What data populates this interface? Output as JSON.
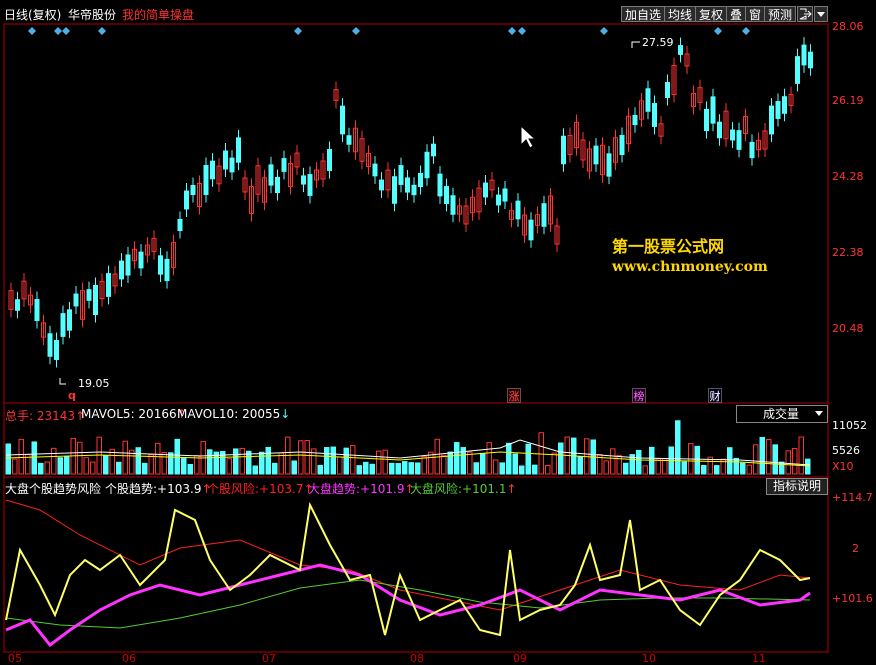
{
  "colors": {
    "up": "#ff3232",
    "down": "#54ffff",
    "frame": "#b00000",
    "axis": "#c00000",
    "ma5": "#ffffff",
    "ma10": "#ffff00",
    "yellow_line": "#ffff66",
    "red_line": "#ff2020",
    "magenta_line": "#ff33ff",
    "green_line": "#55cc33"
  },
  "header": {
    "period": "日线(复权)",
    "stock_name": "华帝股份",
    "template": "我的简单操盘",
    "buttons": [
      "加自选",
      "均线",
      "复权",
      "叠",
      "窗",
      "预测"
    ],
    "extra_icons": [
      "exit-icon",
      "dropdown-icon"
    ]
  },
  "price_axis": [
    "28.06",
    "26.19",
    "24.28",
    "22.38",
    "20.48"
  ],
  "high_marker": "27.59",
  "low_marker": "19.05",
  "low_tag": "q",
  "event_tags": [
    "涨",
    "榜",
    "财"
  ],
  "watermark": {
    "line1": "第一股票公式网",
    "line2": "www.chnmoney.com"
  },
  "volume": {
    "label": "总手",
    "value": "23143",
    "ma5_label": "MAVOL5",
    "ma5_value": "20166",
    "ma10_label": "MAVOL10",
    "ma10_value": "20055",
    "dropdown": "成交量",
    "axis": [
      "11052",
      "5526",
      "X10"
    ]
  },
  "indicator": {
    "name": "大盘个股趋势风险",
    "items": [
      {
        "label": "个股趋势:",
        "value": "+103.9",
        "color": "#ffffff"
      },
      {
        "label": "个股风险:",
        "value": "+103.7",
        "color": "#ff2020"
      },
      {
        "label": "大盘趋势:",
        "value": "+101.9",
        "color": "#ff33ff"
      },
      {
        "label": "大盘风险:",
        "value": "+101.1",
        "color": "#55cc33"
      }
    ],
    "help_button": "指标说明",
    "axis": [
      "+114.7",
      "2",
      "+101.6"
    ]
  },
  "dates": [
    "05",
    "06",
    "07",
    "08",
    "09",
    "10",
    "11"
  ]
}
